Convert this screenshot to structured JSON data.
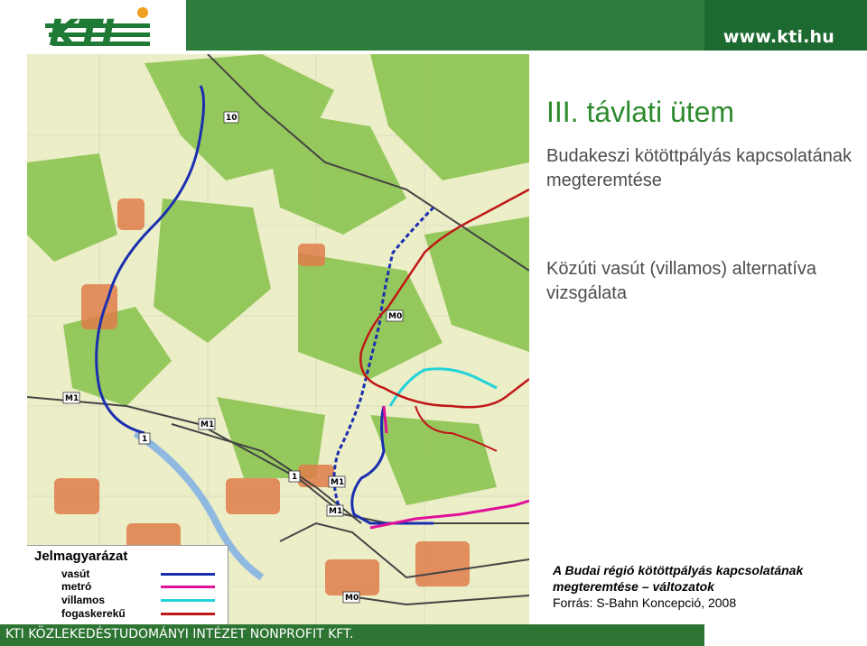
{
  "header": {
    "logo_text": "KTI",
    "url": "www.kti.hu"
  },
  "slide": {
    "title": "III. távlati ütem",
    "subtitle1": "Budakeszi kötöttpályás kapcsolatának megteremtése",
    "subtitle2": "Közúti vasút (villamos) alternatíva vizsgálata",
    "caption_line1": "A Budai régió kötöttpályás kapcsolatának",
    "caption_line2": "megteremtése – változatok",
    "caption_line3": "Forrás: S-Bahn Koncepció, 2008"
  },
  "legend": {
    "title": "Jelmagyarázat",
    "items": [
      {
        "label": "vasút",
        "color": "#1a2fb0"
      },
      {
        "label": "metró",
        "color": "#e0109a"
      },
      {
        "label": "villamos",
        "color": "#22d3d8"
      },
      {
        "label": "fogaskerekű",
        "color": "#c01818"
      }
    ]
  },
  "map": {
    "labels": [
      "10",
      "M0",
      "M1",
      "M1",
      "1",
      "1",
      "M1",
      "M1",
      "M0"
    ],
    "colors": {
      "forest": "#7fbf3f",
      "urban": "#e08050",
      "field": "#e9eccd",
      "water": "#9cc3e5"
    }
  },
  "footer": {
    "text": "KTI KÖZLEKEDÉSTUDOMÁNYI INTÉZET NONPROFIT KFT."
  },
  "colors": {
    "brand_green": "#2f7d3c",
    "title_green": "#2d8b2d"
  }
}
